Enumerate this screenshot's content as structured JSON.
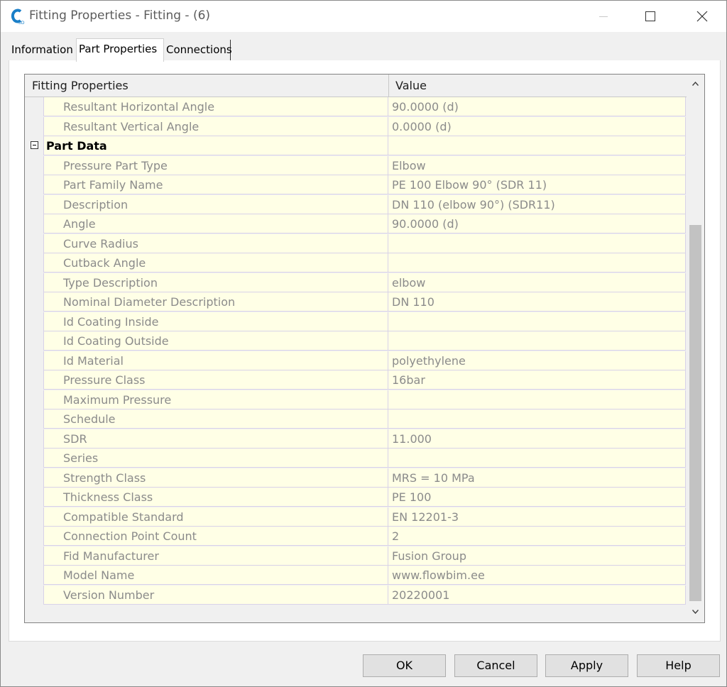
{
  "window": {
    "title": "Fitting Properties - Fitting - (6)"
  },
  "tabs": [
    {
      "label": "Information"
    },
    {
      "label": "Part Properties",
      "selected": true
    },
    {
      "label": "Connections"
    }
  ],
  "grid": {
    "columns": {
      "name": "Fitting Properties",
      "value": "Value"
    },
    "rows": [
      {
        "name": "Resultant Horizontal Angle",
        "value": "90.0000 (d)"
      },
      {
        "name": "Resultant Vertical Angle",
        "value": "0.0000 (d)"
      },
      {
        "name": "Part Data",
        "value": "",
        "category": true
      },
      {
        "name": "Pressure Part Type",
        "value": "Elbow"
      },
      {
        "name": "Part Family Name",
        "value": "PE 100 Elbow 90° (SDR 11)"
      },
      {
        "name": "Description",
        "value": "DN 110 (elbow 90°) (SDR11)"
      },
      {
        "name": "Angle",
        "value": "90.0000 (d)"
      },
      {
        "name": "Curve Radius",
        "value": ""
      },
      {
        "name": "Cutback Angle",
        "value": ""
      },
      {
        "name": "Type Description",
        "value": "elbow"
      },
      {
        "name": "Nominal Diameter Description",
        "value": "DN 110"
      },
      {
        "name": "Id Coating Inside",
        "value": ""
      },
      {
        "name": "Id Coating Outside",
        "value": ""
      },
      {
        "name": "Id Material",
        "value": "polyethylene"
      },
      {
        "name": "Pressure Class",
        "value": "16bar"
      },
      {
        "name": "Maximum Pressure",
        "value": ""
      },
      {
        "name": "Schedule",
        "value": ""
      },
      {
        "name": "SDR",
        "value": "11.000"
      },
      {
        "name": "Series",
        "value": ""
      },
      {
        "name": "Strength Class",
        "value": "MRS = 10 MPa"
      },
      {
        "name": "Thickness Class",
        "value": "PE 100"
      },
      {
        "name": "Compatible Standard",
        "value": "EN 12201-3"
      },
      {
        "name": "Connection Point Count",
        "value": "2"
      },
      {
        "name": "Fid Manufacturer",
        "value": "Fusion Group"
      },
      {
        "name": "Model Name",
        "value": "www.flowbim.ee"
      },
      {
        "name": "Version Number",
        "value": "20220001"
      }
    ]
  },
  "buttons": {
    "ok": "OK",
    "cancel": "Cancel",
    "apply": "Apply",
    "help": "Help"
  },
  "colors": {
    "row_background": "#ffffe6",
    "grid_line": "#d8d2e8",
    "read_only_text": "#8b8b8b"
  }
}
